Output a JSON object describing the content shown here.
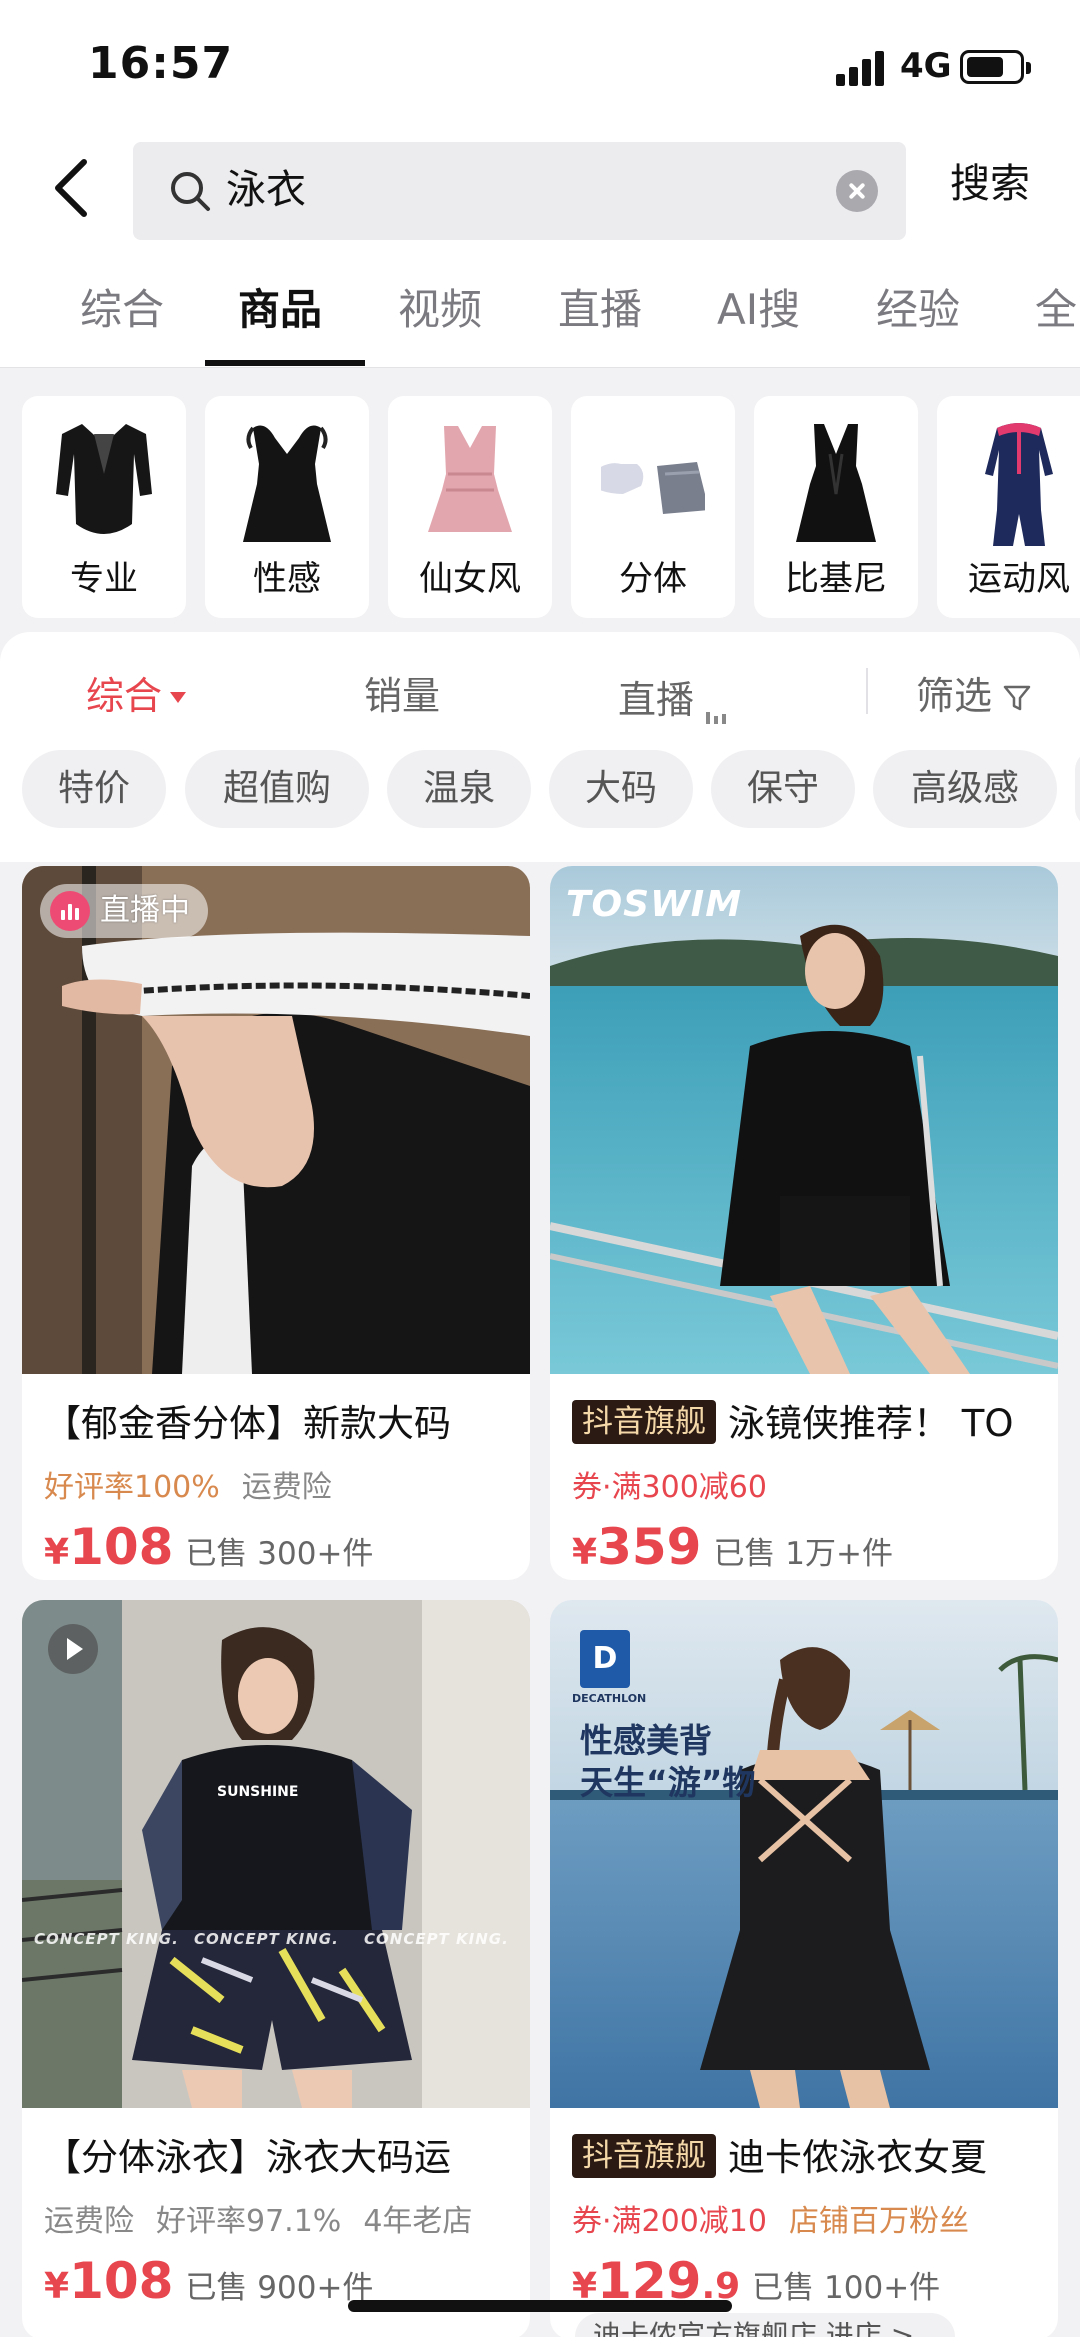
{
  "status_bar": {
    "time": "16:57",
    "network": "4G"
  },
  "search": {
    "query": "泳衣",
    "submit_label": "搜索"
  },
  "tabs": [
    {
      "label": "综合",
      "active": false
    },
    {
      "label": "商品",
      "active": true
    },
    {
      "label": "视频",
      "active": false
    },
    {
      "label": "直播",
      "active": false
    },
    {
      "label": "AI搜",
      "active": false
    },
    {
      "label": "经验",
      "active": false
    },
    {
      "label": "全",
      "active": false
    }
  ],
  "categories": [
    {
      "label": "专业"
    },
    {
      "label": "性感"
    },
    {
      "label": "仙女风"
    },
    {
      "label": "分体"
    },
    {
      "label": "比基尼"
    },
    {
      "label": "运动风"
    }
  ],
  "sort": {
    "comprehensive": "综合",
    "sales": "销量",
    "live": "直播",
    "filter": "筛选"
  },
  "chips": [
    "特价",
    "超值购",
    "温泉",
    "大码",
    "保守",
    "高级感"
  ],
  "products": [
    {
      "badge": "直播中",
      "title": "【郁金香分体】新款大码",
      "meta": [
        "好评率100%",
        "运费险"
      ],
      "price_symbol": "¥",
      "price": "108",
      "price_decimal": "",
      "sold": "已售 300+件"
    },
    {
      "brand_overlay": "TOSWIM",
      "flag": "抖音旗舰",
      "title": "泳镜侠推荐！ TO",
      "meta": [
        "券·满300减60"
      ],
      "price_symbol": "¥",
      "price": "359",
      "price_decimal": "",
      "sold": "已售 1万+件"
    },
    {
      "overlay": "CONCEPT KING.",
      "title": "【分体泳衣】泳衣大码运",
      "meta": [
        "运费险",
        "好评率97.1%",
        "4年老店"
      ],
      "price_symbol": "¥",
      "price": "108",
      "price_decimal": "",
      "sold": "已售 900+件"
    },
    {
      "logo_letter": "D",
      "logo_text": "DECATHLON",
      "promo_line1": "性感美背",
      "promo_line2": "天生“游”物",
      "flag": "抖音旗舰",
      "title": "迪卡侬泳衣女夏",
      "meta": [
        "券·满200减10",
        "店铺百万粉丝"
      ],
      "price_symbol": "¥",
      "price": "129",
      "price_decimal": ".9",
      "sold": "已售 100+件",
      "shop_strip": "迪卡侬官方旗舰店 进店 >"
    }
  ],
  "colors": {
    "accent_red": "#e8464e",
    "meta_orange": "#d88a4e",
    "live_pink": "#ee4b74"
  }
}
